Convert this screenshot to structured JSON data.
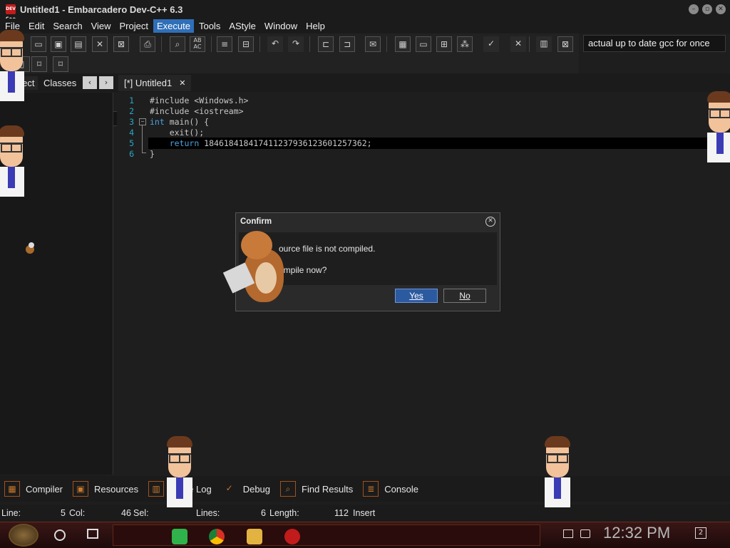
{
  "window": {
    "title": "Untitled1 - Embarcadero Dev-C++ 6.3",
    "app_icon_text": "DEV C++"
  },
  "menu": [
    "File",
    "Edit",
    "Search",
    "View",
    "Project",
    "Execute",
    "Tools",
    "AStyle",
    "Window",
    "Help"
  ],
  "menu_active": "Execute",
  "toolbar": {
    "compiler_select_value": "actual up to date gcc for once"
  },
  "left_panel": {
    "tabs": [
      "Project",
      "Classes"
    ],
    "tab0_visible": "oject",
    "nav_prev": "‹",
    "nav_next": "›"
  },
  "editor": {
    "tab_label": "[*] Untitled1",
    "tab_close": "✕",
    "line_numbers": [
      "1",
      "2",
      "3",
      "4",
      "5",
      "6"
    ],
    "lines": [
      {
        "pre": "#include <Windows.h>",
        "kw": "",
        "post": ""
      },
      {
        "pre": "#include <iostream>",
        "kw": "",
        "post": ""
      },
      {
        "pre": "",
        "kw": "int",
        "post": " main() {"
      },
      {
        "pre": "    exit();",
        "kw": "",
        "post": ""
      },
      {
        "pre": "    ",
        "kw": "return",
        "post": " 18461841841741123793612360125736​2;"
      },
      {
        "pre": "}",
        "kw": "",
        "post": ""
      }
    ],
    "highlighted_line": 5
  },
  "bottom_tabs": [
    {
      "label": "Compiler",
      "icon": "grid-icon"
    },
    {
      "label": "Resources",
      "icon": "resources-icon"
    },
    {
      "label": "Compile Log",
      "visible_label": "C   ile Log",
      "icon": "chart-icon"
    },
    {
      "label": "Debug",
      "icon": "check-icon"
    },
    {
      "label": "Find Results",
      "icon": "find-icon"
    },
    {
      "label": "Console",
      "icon": "console-icon"
    }
  ],
  "status_bar": {
    "line_label": "Line:",
    "line_value": "5",
    "col_label": "Col:",
    "col_value": "46",
    "sel_label": "Sel:",
    "lines_label": "Lines:",
    "lines_value": "6",
    "length_label": "Length:",
    "length_value": "112",
    "mode": "Insert"
  },
  "dialog": {
    "title": "Confirm",
    "message_line1": "Source file is not compiled.",
    "message_line1_visible": "ource file is not compiled.",
    "message_line2": "Compile now?",
    "message_line2_visible": "ompile now?",
    "yes_label": "Yes",
    "no_label": "No",
    "close_glyph": "✕"
  },
  "taskbar": {
    "time": "12:32 PM",
    "notification_count": "2",
    "apps": [
      "notes-app",
      "chrome-app",
      "file-explorer-app",
      "devcpp-app"
    ]
  },
  "colors": {
    "accent": "#2f6fb8",
    "keyword": "#4aa3e0",
    "gutter": "#2aa7c4",
    "taskbar": "#3a1616"
  }
}
